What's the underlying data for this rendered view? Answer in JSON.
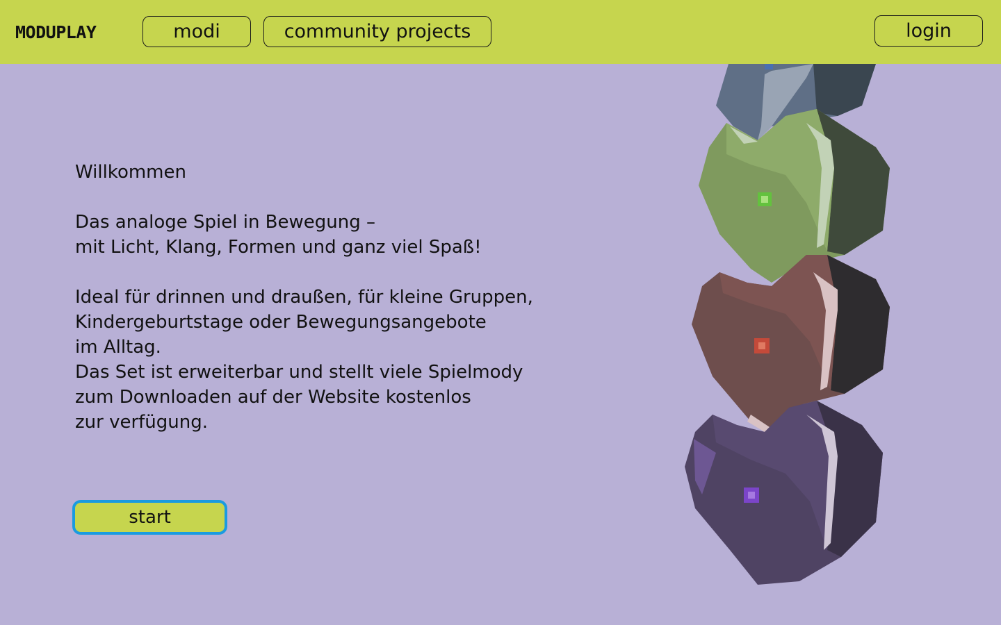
{
  "header": {
    "logo": "MODUPLAY",
    "nav": {
      "modi": "modi",
      "community": "community projects",
      "login": "login"
    }
  },
  "main": {
    "heading": "Willkommen",
    "tagline_lines": [
      "Das analoge Spiel in Bewegung –",
      "mit Licht, Klang, Formen und ganz viel Spaß!"
    ],
    "body_lines": [
      "Ideal für drinnen und draußen, für kleine Gruppen,",
      "Kindergeburtstage oder Bewegungsangebote",
      "im Alltag.",
      "Das Set ist erweiterbar und stellt viele Spielmody",
      "zum Downloaden auf der Website kostenlos",
      "zur verfügung."
    ],
    "start_label": "start"
  },
  "colors": {
    "background": "#b8b0d6",
    "topbar": "#c6d54e",
    "start_border": "#1a9be0",
    "module_blue": "#5f6f86",
    "module_green": "#7f9a5e",
    "module_brown": "#6e4e4d",
    "module_purple": "#4f4363"
  },
  "icons": {
    "hero": "stacked-heart-modules-illustration"
  }
}
